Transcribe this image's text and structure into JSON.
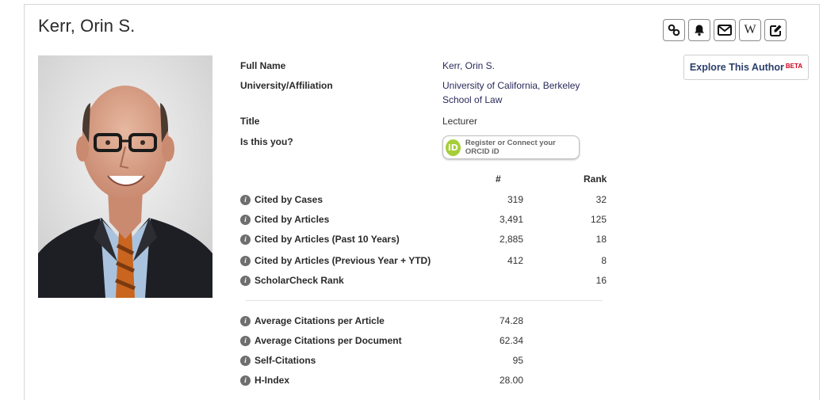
{
  "author": {
    "name": "Kerr, Orin S."
  },
  "toolbar": {
    "icons": [
      "link-icon",
      "bell-icon",
      "envelope-icon",
      "wikipedia-icon",
      "edit-icon"
    ],
    "wikipedia_glyph": "W",
    "explore_label": "Explore This Author",
    "explore_badge": "BETA"
  },
  "profile": {
    "full_name_label": "Full Name",
    "full_name_value": "Kerr, Orin S.",
    "affiliation_label": "University/Affiliation",
    "affiliation_line1": "University of California, Berkeley",
    "affiliation_line2": "School of Law",
    "title_label": "Title",
    "title_value": "Lecturer",
    "is_you_label": "Is this you?",
    "orcid_logo_text": "iD",
    "orcid_button": "Register or Connect your ORCID iD"
  },
  "metrics": {
    "col_count": "#",
    "col_rank": "Rank",
    "rows": [
      {
        "label": "Cited by Cases",
        "count": "319",
        "rank": "32"
      },
      {
        "label": "Cited by Articles",
        "count": "3,491",
        "rank": "125"
      },
      {
        "label": "Cited by Articles (Past 10 Years)",
        "count": "2,885",
        "rank": "18"
      },
      {
        "label": "Cited by Articles (Previous Year + YTD)",
        "count": "412",
        "rank": "8"
      },
      {
        "label": "ScholarCheck Rank",
        "count": "",
        "rank": "16"
      }
    ],
    "averages": [
      {
        "label": "Average Citations per Article",
        "value": "74.28"
      },
      {
        "label": "Average Citations per Document",
        "value": "62.34"
      },
      {
        "label": "Self-Citations",
        "value": "95"
      },
      {
        "label": "H-Index",
        "value": "28.00"
      }
    ],
    "info_glyph": "i"
  },
  "colors": {
    "orcid_green": "#a6ce39",
    "beta_red": "#d0021b",
    "link_blue": "#2a3f6a"
  }
}
